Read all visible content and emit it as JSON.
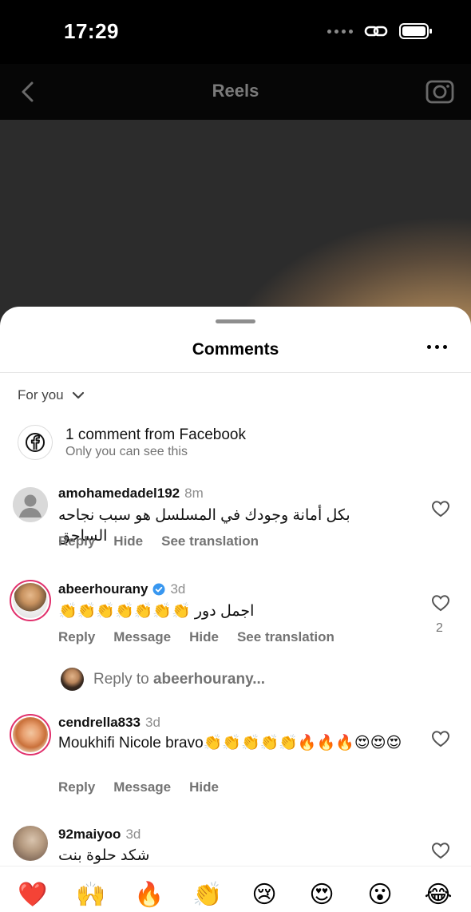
{
  "status": {
    "time": "17:29"
  },
  "nav": {
    "title": "Reels"
  },
  "sheet": {
    "title": "Comments"
  },
  "filter": {
    "label": "For you"
  },
  "facebook": {
    "title": "1 comment from Facebook",
    "subtitle": "Only you can see this"
  },
  "comments": [
    {
      "user": "amohamedadel192",
      "time": "8m",
      "text": "بكل أمانة وجودك في المسلسل هو سبب نجاحه الساحق",
      "actions": [
        "Reply",
        "Hide",
        "See translation"
      ]
    },
    {
      "user": "abeerhourany",
      "time": "3d",
      "text": "اجمل دور 👏👏👏👏👏👏👏",
      "actions": [
        "Reply",
        "Message",
        "Hide",
        "See translation"
      ],
      "likes": "2"
    },
    {
      "user": "cendrella833",
      "time": "3d",
      "text": "Moukhifi Nicole bravo👏👏👏👏👏🔥🔥🔥😍😍😍",
      "actions": [
        "Reply",
        "Message",
        "Hide"
      ]
    },
    {
      "user": "92maiyoo",
      "time": "3d",
      "text": "شكد حلوة بنت الأبلسة"
    }
  ],
  "reply_to": {
    "prefix": "Reply to",
    "user": "abeerhourany..."
  },
  "emoji_bar": [
    "❤️",
    "🙌",
    "🔥",
    "👏",
    "😢",
    "😍",
    "😮",
    "😂"
  ],
  "colors": {
    "ring": "#e1306c",
    "verified": "#3897f0",
    "heart": "#ed4956"
  }
}
